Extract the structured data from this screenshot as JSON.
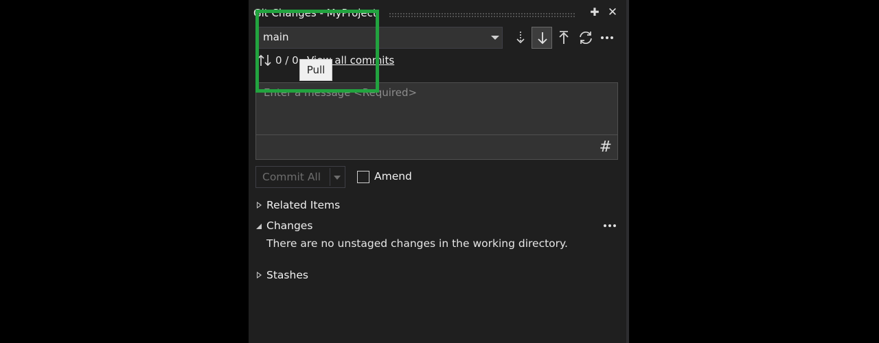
{
  "window": {
    "title": "Git Changes - MyProject"
  },
  "branch": {
    "name": "main"
  },
  "toolbar": {
    "fetch_icon": "fetch-icon",
    "pull_icon": "pull-icon",
    "push_icon": "push-icon",
    "sync_icon": "sync-icon",
    "more_icon": "more-icon",
    "tooltip": "Pull",
    "highlight_color": "#22a33f"
  },
  "commits": {
    "count": "0 / 0",
    "view_all_label": "View all commits"
  },
  "message": {
    "placeholder": "Enter a message <Required>",
    "value": "",
    "hash_glyph": "#"
  },
  "commit": {
    "button_label": "Commit All",
    "amend_label": "Amend",
    "amend_checked": false
  },
  "sections": {
    "related_items": "Related Items",
    "changes": "Changes",
    "changes_message": "There are no unstaged changes in the working directory.",
    "stashes": "Stashes"
  },
  "colors": {
    "accent": "#7160e8",
    "panel_bg": "#1f1f1f"
  }
}
